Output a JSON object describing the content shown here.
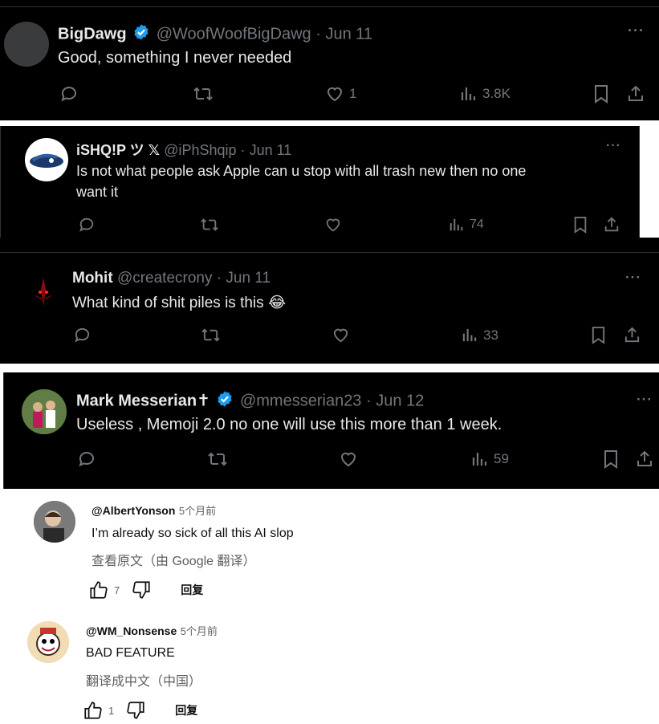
{
  "tweets": [
    {
      "name": "BigDawg",
      "handle": "@WoofWoofBigDawg",
      "sep": "·",
      "date": "Jun 11",
      "text": "Good, something I never needed",
      "likes": "1",
      "views": "3.8K",
      "verified": true
    },
    {
      "name": "iSHQ!P ツ 𝕏",
      "handle": "@iPhShqip",
      "sep": "·",
      "date": "Jun 11",
      "text_line1": "Is not what people ask Apple can u stop with all trash new then no one",
      "text_line2": "want it",
      "views": "74"
    },
    {
      "name": "Mohit",
      "handle": "@createcrony",
      "sep": "·",
      "date": "Jun 11",
      "text": "What kind of shit piles is this",
      "emoji": "😂",
      "views": "33"
    },
    {
      "name": "Mark Messerian✝",
      "handle": "@mmesserian23",
      "sep": "·",
      "date": "Jun 12",
      "text": "Useless , Memoji 2.0 no one will use this more than 1 week.",
      "views": "59",
      "verified": true
    }
  ],
  "more_label": "···",
  "youtube_comments": [
    {
      "author": "@AlbertYonson",
      "time": "5个月前",
      "text": "I’m already so sick of all this AI slop",
      "translate": "查看原文（由 Google 翻译）",
      "likes": "7",
      "reply": "回复"
    },
    {
      "author": "@WM_Nonsense",
      "time": "5个月前",
      "text": "BAD FEATURE",
      "translate": "翻译成中文（中国）",
      "likes": "1",
      "reply": "回复"
    }
  ],
  "colors": {
    "tweet_bg": "#000000",
    "verified_blue": "#1d9bf0",
    "muted": "#71767b"
  }
}
